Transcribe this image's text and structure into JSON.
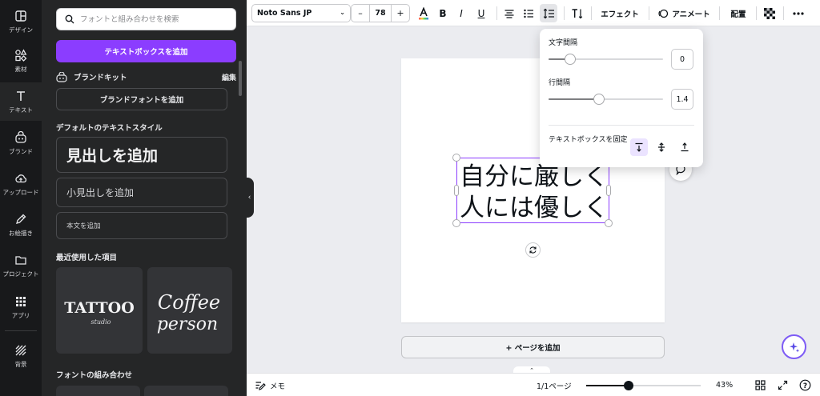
{
  "rail": {
    "items": [
      {
        "label": "デザイン",
        "icon": "layout-icon"
      },
      {
        "label": "素材",
        "icon": "shapes-icon"
      },
      {
        "label": "テキスト",
        "icon": "text-icon"
      },
      {
        "label": "ブランド",
        "icon": "brand-icon"
      },
      {
        "label": "アップロード",
        "icon": "upload-icon"
      },
      {
        "label": "お絵描き",
        "icon": "draw-icon"
      },
      {
        "label": "プロジェクト",
        "icon": "folder-icon"
      },
      {
        "label": "アプリ",
        "icon": "apps-icon"
      },
      {
        "label": "背景",
        "icon": "background-icon"
      }
    ],
    "active_index": 2
  },
  "panel": {
    "search_placeholder": "フォントと組み合わせを検索",
    "add_textbox": "テキストボックスを追加",
    "brand_kit_label": "ブランドキット",
    "brand_edit": "編集",
    "add_brand_font": "ブランドフォントを追加",
    "default_styles_title": "デフォルトのテキストスタイル",
    "heading": "見出しを追加",
    "subheading": "小見出しを追加",
    "body_text": "本文を追加",
    "recent_title": "最近使用した項目",
    "recent_items": [
      {
        "line1": "TATTOO",
        "line2": "studio"
      },
      {
        "line1": "Coffee",
        "line2": "person"
      }
    ],
    "combos_title": "フォントの組み合わせ"
  },
  "toolbar": {
    "font_name": "Noto Sans JP",
    "font_size": "78",
    "minus": "–",
    "plus": "+",
    "bold": "B",
    "italic": "I",
    "underline": "U",
    "effects": "エフェクト",
    "animate": "アニメート",
    "position": "配置",
    "text_color": "#0e1318"
  },
  "canvas": {
    "text_lines": [
      "自分に厳しく",
      "人には優しく"
    ],
    "add_page": "+ ページを追加"
  },
  "spacing_popover": {
    "letter_spacing_label": "文字間隔",
    "letter_spacing_value": "0",
    "letter_spacing_fraction": 0.19,
    "line_spacing_label": "行間隔",
    "line_spacing_value": "1.4",
    "line_spacing_fraction": 0.44,
    "anchor_label": "テキストボックスを固定"
  },
  "bottombar": {
    "notes": "メモ",
    "page_indicator": "1/1ページ",
    "zoom": "43%",
    "zoom_fraction": 0.37,
    "help": "?"
  },
  "colors": {
    "accent": "#8b3dff",
    "rail_bg": "#18191b",
    "panel_bg": "#252627"
  }
}
